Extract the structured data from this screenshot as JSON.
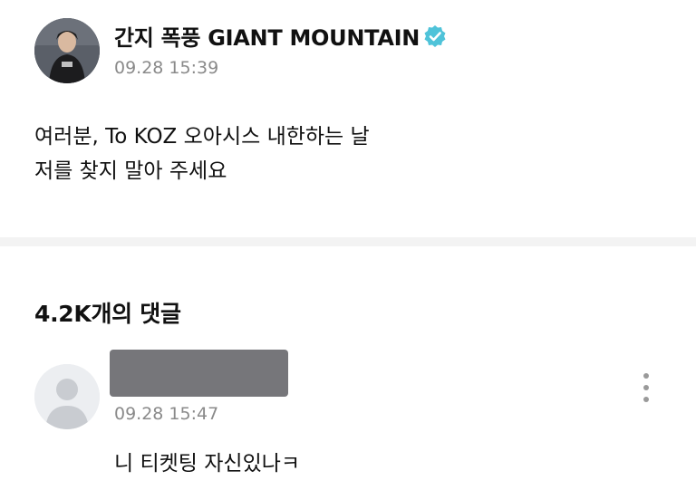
{
  "post": {
    "author": "간지 폭풍 GIANT MOUNTAIN",
    "verified": true,
    "timestamp": "09.28 15:39",
    "body_lines": [
      "여러분, To KOZ 오아시스 내한하는 날",
      "저를 찾지 말아 주세요"
    ]
  },
  "comments_section": {
    "heading": "4.2K개의 댓글",
    "comments": [
      {
        "author_redacted": true,
        "timestamp": "09.28 15:47",
        "text": "니 티켓팅 자신있나ㅋ",
        "more_icon": "more-vertical-icon"
      }
    ]
  },
  "colors": {
    "verified_badge": "#4fc3d9",
    "timestamp": "#8a8a8a",
    "divider": "#f3f3f3",
    "redaction": "#76767a"
  }
}
